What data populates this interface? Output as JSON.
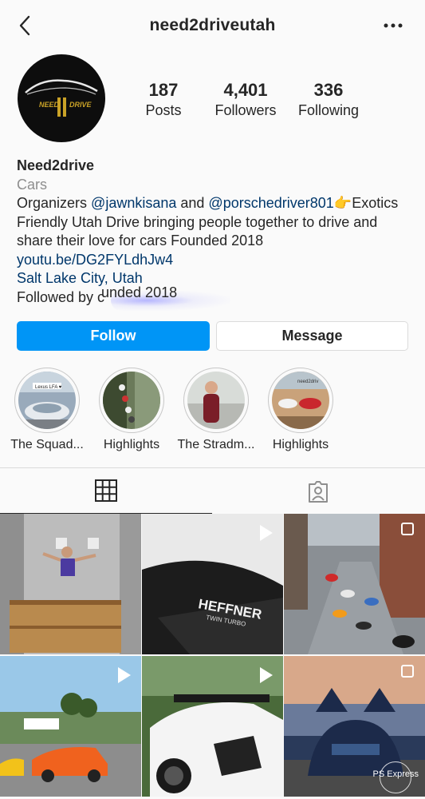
{
  "header": {
    "username": "need2driveutah"
  },
  "avatar": {
    "logo_left": "NEED",
    "logo_right": "DRIVE"
  },
  "stats": [
    {
      "value": "187",
      "label": "Posts"
    },
    {
      "value": "4,401",
      "label": "Followers"
    },
    {
      "value": "336",
      "label": "Following"
    }
  ],
  "bio": {
    "name": "Need2drive",
    "category": "Cars",
    "line1_prefix": "Organizers ",
    "mention1": "@jawnkisana",
    "line1_mid": " and ",
    "mention2": "@porschedriver801",
    "line1_suffix": "👉Exotics",
    "line2": "Friendly Utah Drive bringing people together to drive and",
    "line3": "share their love for cars Founded 2018",
    "website": "youtu.be/DG2FYLdhJw4",
    "location": "Salt Lake City, Utah",
    "followed_by": "Followed by c",
    "overlay": "unded 2018"
  },
  "buttons": {
    "follow": "Follow",
    "message": "Message"
  },
  "highlights": [
    {
      "label": "The Squad...",
      "tag": "Lexus LFA ♥"
    },
    {
      "label": "Highlights"
    },
    {
      "label": "The Stradm..."
    },
    {
      "label": "Highlights",
      "tag": "need2driv"
    }
  ],
  "grid": {
    "watermark_line": "PS Express",
    "car_text_1": "HEFFNER",
    "car_text_2": "TWIN TURBO"
  },
  "colors": {
    "accent": "#0095f6",
    "link": "#00376b",
    "muted": "#8e8e8e"
  }
}
